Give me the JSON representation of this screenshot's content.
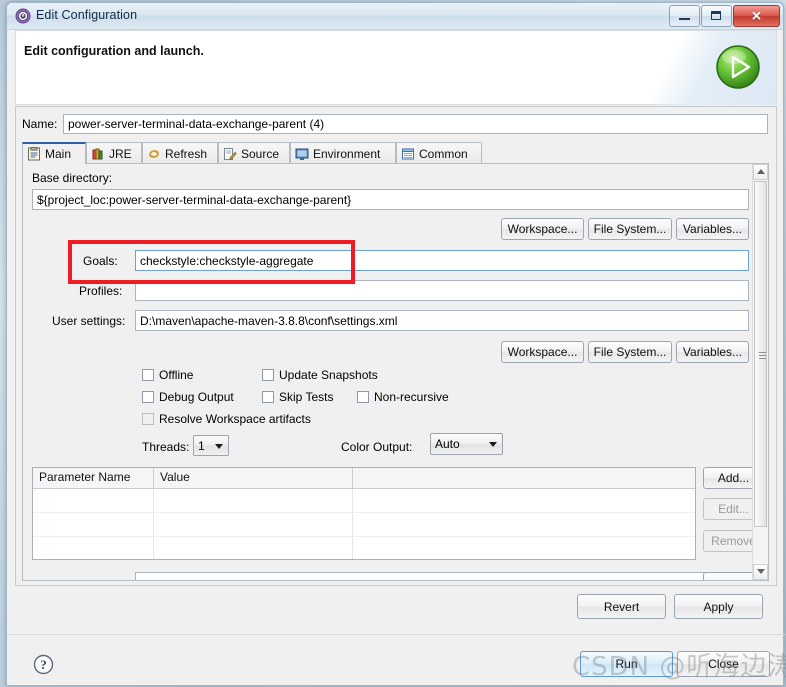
{
  "window": {
    "title": "Edit Configuration",
    "icon": "eclipse-launch-icon",
    "minimize_label": "Minimize",
    "maximize_label": "Maximize",
    "close_label": "Close"
  },
  "banner": {
    "title": "Edit configuration and launch.",
    "run_icon": "green-run-play-icon"
  },
  "name": {
    "label": "Name:",
    "value": "power-server-terminal-data-exchange-parent (4)"
  },
  "tabs": [
    {
      "label": "Main",
      "icon": "main-clipboard-icon",
      "selected": true
    },
    {
      "label": "JRE",
      "icon": "jre-books-icon",
      "selected": false
    },
    {
      "label": "Refresh",
      "icon": "refresh-arrows-icon",
      "selected": false
    },
    {
      "label": "Source",
      "icon": "source-pencil-icon",
      "selected": false
    },
    {
      "label": "Environment",
      "icon": "environment-monitor-icon",
      "selected": false
    },
    {
      "label": "Common",
      "icon": "common-window-icon",
      "selected": false
    }
  ],
  "main": {
    "base_directory": {
      "label": "Base directory:",
      "value": "${project_loc:power-server-terminal-data-exchange-parent}"
    },
    "dir_buttons": [
      {
        "label": "Workspace..."
      },
      {
        "label": "File System..."
      },
      {
        "label": "Variables..."
      }
    ],
    "goals": {
      "label": "Goals:",
      "value": "checkstyle:checkstyle-aggregate"
    },
    "profiles": {
      "label": "Profiles:",
      "value": ""
    },
    "user_settings": {
      "label": "User settings:",
      "value": "D:\\maven\\apache-maven-3.8.8\\conf\\settings.xml"
    },
    "settings_buttons": [
      {
        "label": "Workspace..."
      },
      {
        "label": "File System..."
      },
      {
        "label": "Variables..."
      }
    ],
    "checkboxes": [
      {
        "label": "Offline",
        "checked": false,
        "enabled": true
      },
      {
        "label": "Update Snapshots",
        "checked": false,
        "enabled": true
      },
      {
        "label": "Debug Output",
        "checked": false,
        "enabled": true
      },
      {
        "label": "Skip Tests",
        "checked": false,
        "enabled": true
      },
      {
        "label": "Non-recursive",
        "checked": false,
        "enabled": true
      },
      {
        "label": "Resolve Workspace artifacts",
        "checked": false,
        "enabled": false
      }
    ],
    "threads": {
      "label": "Threads:",
      "value": "1"
    },
    "color_output": {
      "label": "Color Output:",
      "value": "Auto"
    },
    "parameters_table": {
      "columns": [
        "Parameter Name",
        "Value",
        ""
      ],
      "rows": [
        [
          "",
          "",
          ""
        ],
        [
          "",
          "",
          ""
        ],
        [
          "",
          "",
          ""
        ]
      ]
    },
    "table_buttons": [
      {
        "label": "Add...",
        "enabled": true
      },
      {
        "label": "Edit...",
        "enabled": false
      },
      {
        "label": "Remove",
        "enabled": false
      }
    ]
  },
  "footer": {
    "revert": "Revert",
    "apply": "Apply",
    "run": "Run",
    "close": "Close",
    "help_icon": "help-question-icon"
  },
  "watermark": "CSDN @听海边涛声",
  "colors": {
    "highlight": "#ee1c24",
    "tab_selected_accent": "#2d62a8",
    "run_green": "#4aa32a"
  }
}
